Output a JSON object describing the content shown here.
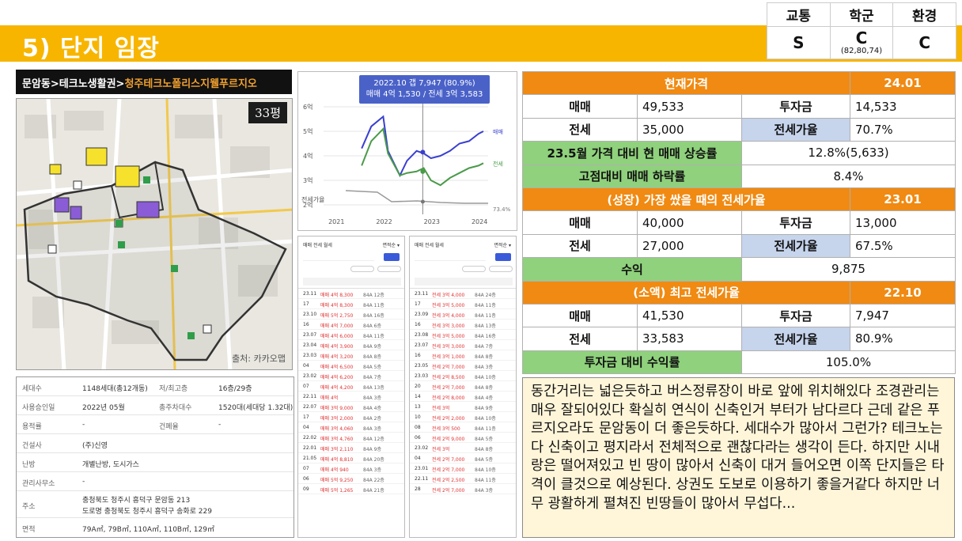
{
  "header": {
    "title": "5) 단지 임장",
    "grades": {
      "headers": [
        "교통",
        "학군",
        "환경"
      ],
      "values": [
        "S",
        "C",
        "C"
      ],
      "school_sub": "(82,80,74)"
    }
  },
  "location": {
    "prefix": "문암동>테크노생활권>",
    "name": "청주테크노폴리스지웰푸르지오"
  },
  "map": {
    "size_badge": "33평",
    "credit": "출처: 카카오맵"
  },
  "info": [
    {
      "label": "세대수",
      "value": "1148세대(총12개동)",
      "label2": "저/최고층",
      "value2": "16층/29층"
    },
    {
      "label": "사용승인일",
      "value": "2022년 05월",
      "label2": "총주차대수",
      "value2": "1520대(세대당 1.32대)"
    },
    {
      "label": "용적률",
      "value": "-",
      "label2": "건폐율",
      "value2": "-"
    },
    {
      "label": "건설사",
      "value": "(주)신영",
      "label2": "",
      "value2": ""
    },
    {
      "label": "난방",
      "value": "개별난방, 도시가스",
      "label2": "",
      "value2": ""
    },
    {
      "label": "관리사무소",
      "value": "-",
      "label2": "",
      "value2": ""
    },
    {
      "label": "주소",
      "value": "충청북도 청주시 흥덕구 문암동 213",
      "value_b": "도로명 충청북도 청주시 흥덕구 송화로 229",
      "label2": "",
      "value2": ""
    },
    {
      "label": "면적",
      "value": "79A㎡, 79B㎡, 110A㎡, 110B㎡, 129㎡",
      "label2": "",
      "value2": ""
    }
  ],
  "chart_data": {
    "type": "line",
    "tooltip_line1": "2022.10 갭 7,947 (80.9%)",
    "tooltip_line2": "매매 4억 1,530 / 전세 3억 3,583",
    "x_ticks": [
      "2021",
      "2022",
      "2023",
      "2024"
    ],
    "y_ticks": [
      "2억",
      "3억",
      "4억",
      "5억",
      "6억"
    ],
    "ylim": [
      2,
      6
    ],
    "xlim": [
      2020.75,
      2024.2
    ],
    "series": [
      {
        "name": "매매",
        "color": "#3a3fd0",
        "x": [
          2021.55,
          2021.75,
          2022.0,
          2022.1,
          2022.35,
          2022.5,
          2022.7,
          2022.85,
          2023.0,
          2023.2,
          2023.4,
          2023.6,
          2023.8,
          2024.0,
          2024.1
        ],
        "y": [
          4.3,
          5.2,
          5.6,
          4.2,
          3.2,
          3.8,
          4.2,
          4.1,
          3.9,
          4.0,
          4.2,
          4.5,
          4.6,
          4.9,
          5.0
        ]
      },
      {
        "name": "전세",
        "color": "#4a9a4a",
        "x": [
          2021.55,
          2021.75,
          2022.0,
          2022.1,
          2022.35,
          2022.5,
          2022.7,
          2022.85,
          2023.0,
          2023.2,
          2023.4,
          2023.6,
          2023.8,
          2024.0,
          2024.1
        ],
        "y": [
          3.6,
          4.6,
          5.1,
          4.1,
          3.2,
          3.3,
          3.36,
          3.5,
          3.0,
          2.8,
          3.1,
          3.3,
          3.5,
          3.6,
          3.7
        ]
      }
    ],
    "ratio_label": "전세가율",
    "ratio_value": "73.4%",
    "end_label_sale": "매매",
    "end_label_jeonse": "전세"
  },
  "txlists": [
    {
      "tab": "매매  전세  월세",
      "sort": "면적순 ▾",
      "rows": [
        {
          "d": "23.11",
          "p": "매매 4억 8,300",
          "q": "84A 12층"
        },
        {
          "d": "17",
          "p": "매매 4억 8,300",
          "q": "84A 11층"
        },
        {
          "d": "23.10",
          "p": "매매 5억 2,750",
          "q": "84A 16층"
        },
        {
          "d": "16",
          "p": "매매 4억 7,000",
          "q": "84A 6층"
        },
        {
          "d": "23.07",
          "p": "매매 4억 6,000",
          "q": "84A 11층"
        },
        {
          "d": "23.04",
          "p": "매매 4억 3,900",
          "q": "84A 9층"
        },
        {
          "d": "23.03",
          "p": "매매 4억 3,200",
          "q": "84A 8층"
        },
        {
          "d": "04",
          "p": "매매 4억 6,500",
          "q": "84A 5층"
        },
        {
          "d": "23.02",
          "p": "매매 4억 6,200",
          "q": "84A 7층"
        },
        {
          "d": "07",
          "p": "매매 4억 4,200",
          "q": "84A 13층"
        },
        {
          "d": "22.11",
          "p": "매매 4억",
          "q": "84A 3층"
        },
        {
          "d": "22.07",
          "p": "매매 3억 9,000",
          "q": "84A 4층"
        },
        {
          "d": "17",
          "p": "매매 3억 2,000",
          "q": "84A 2층"
        },
        {
          "d": "04",
          "p": "매매 3억 4,060",
          "q": "84A 3층"
        },
        {
          "d": "22.02",
          "p": "매매 3억 4,760",
          "q": "84A 12층"
        },
        {
          "d": "22.01",
          "p": "매매 3억 2,110",
          "q": "84A 9층"
        },
        {
          "d": "21.05",
          "p": "매매 4억 8,810",
          "q": "84A 20층"
        },
        {
          "d": "07",
          "p": "매매 4억 940",
          "q": "84A 3층"
        },
        {
          "d": "06",
          "p": "매매 5억 9,250",
          "q": "84A 22층"
        },
        {
          "d": "09",
          "p": "매매 5억 1,265",
          "q": "84A 21층"
        }
      ]
    },
    {
      "tab": "매매  전세  월세",
      "sort": "면적순 ▾",
      "rows": [
        {
          "d": "23.11",
          "p": "전세 3억 4,000",
          "q": "84A 24층"
        },
        {
          "d": "17",
          "p": "전세 3억 5,000",
          "q": "84A 11층"
        },
        {
          "d": "23.09",
          "p": "전세 3억 4,000",
          "q": "84A 11층"
        },
        {
          "d": "16",
          "p": "전세 3억 3,000",
          "q": "84A 13층"
        },
        {
          "d": "23.08",
          "p": "전세 3억 5,000",
          "q": "84A 16층"
        },
        {
          "d": "23.07",
          "p": "전세 3억 3,000",
          "q": "84A 7층"
        },
        {
          "d": "16",
          "p": "전세 3억 1,000",
          "q": "84A 8층"
        },
        {
          "d": "23.05",
          "p": "전세 2억 7,000",
          "q": "84A 3층"
        },
        {
          "d": "23.03",
          "p": "전세 2억 8,500",
          "q": "84A 10층"
        },
        {
          "d": "20",
          "p": "전세 2억 7,000",
          "q": "84A 8층"
        },
        {
          "d": "14",
          "p": "전세 2억 8,000",
          "q": "84A 4층"
        },
        {
          "d": "13",
          "p": "전세 3억",
          "q": "84A 9층"
        },
        {
          "d": "10",
          "p": "전세 2억 2,000",
          "q": "84A 10층"
        },
        {
          "d": "08",
          "p": "전세 3억 500",
          "q": "84A 11층"
        },
        {
          "d": "06",
          "p": "전세 2억 9,000",
          "q": "84A 5층"
        },
        {
          "d": "23.02",
          "p": "전세 3억",
          "q": "84A 8층"
        },
        {
          "d": "04",
          "p": "전세 2억 7,000",
          "q": "84A 5층"
        },
        {
          "d": "23.01",
          "p": "전세 2억 7,000",
          "q": "84A 10층"
        },
        {
          "d": "22.11",
          "p": "전세 2억 2,500",
          "q": "84A 11층"
        },
        {
          "d": "28",
          "p": "전세 2억 7,000",
          "q": "84A 3층"
        }
      ]
    }
  ],
  "price": {
    "current_label": "현재가격",
    "current_date": "24.01",
    "current_sale_label": "매매",
    "current_sale": "49,533",
    "current_invest_label": "투자금",
    "current_invest": "14,533",
    "current_jeonse_label": "전세",
    "current_jeonse": "35,000",
    "current_ratio_label": "전세가율",
    "current_ratio": "70.7%",
    "rise_label": "23.5월 가격 대비 현 매매 상승률",
    "rise_value": "12.8%(5,633)",
    "drop_label": "고점대비 매매 하락률",
    "drop_value": "8.4%",
    "growth_label": "(성장) 가장 쌌을 때의 전세가율",
    "growth_date": "23.01",
    "growth_sale_label": "매매",
    "growth_sale": "40,000",
    "growth_invest_label": "투자금",
    "growth_invest": "13,000",
    "growth_jeonse_label": "전세",
    "growth_jeonse": "27,000",
    "growth_ratio_label": "전세가율",
    "growth_ratio": "67.5%",
    "profit_label": "수익",
    "profit_value": "9,875",
    "small_label": "(소액) 최고 전세가율",
    "small_date": "22.10",
    "small_sale_label": "매매",
    "small_sale": "41,530",
    "small_invest_label": "투자금",
    "small_invest": "7,947",
    "small_jeonse_label": "전세",
    "small_jeonse": "33,583",
    "small_ratio_label": "전세가율",
    "small_ratio": "80.9%",
    "yield_label": "투자금 대비 수익률",
    "yield_value": "105.0%"
  },
  "comment": "동간거리는 넓은듯하고 버스정류장이 바로 앞에 위치해있다 조경관리는 매우 잘되어있다 확실히 연식이 신축인거 부터가 남다르다 근데 같은 푸르지오라도 문암동이 더 좋은듯하다. 세대수가 많아서 그런가? 테크노는 다 신축이고 평지라서 전체적으로 괜찮다라는 생각이 든다. 하지만 시내랑은 떨어져있고 빈 땅이 많아서 신축이 대거 들어오면 이쪽 단지들은 타격이 클것으로 예상된다. 상권도 도보로 이용하기 좋을거같다 하지만 너무 광활하게 펼쳐진 빈땅들이 많아서 무섭다..."
}
